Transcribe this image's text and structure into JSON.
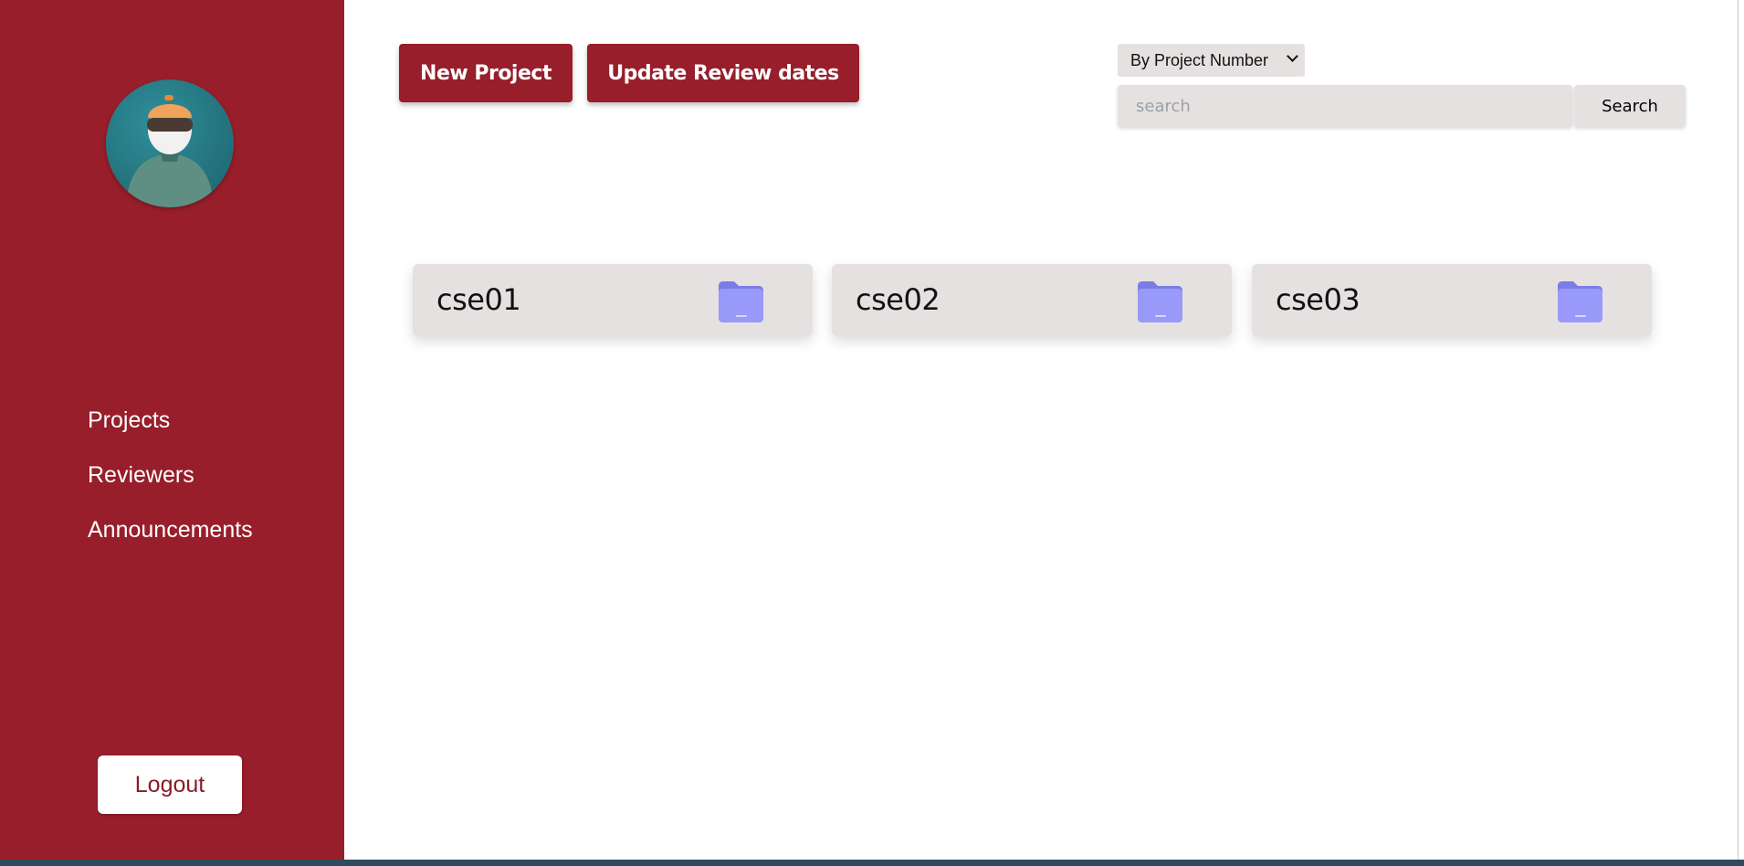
{
  "sidebar": {
    "nav": [
      "Projects",
      "Reviewers",
      "Announcements"
    ],
    "logout_label": "Logout"
  },
  "toolbar": {
    "new_project_label": "New Project",
    "update_review_label": "Update Review dates"
  },
  "search": {
    "sort_selected": "By Project Number",
    "placeholder": "search",
    "button_label": "Search"
  },
  "projects": [
    {
      "name": "cse01",
      "icon": "folder-icon"
    },
    {
      "name": "cse02",
      "icon": "folder-icon"
    },
    {
      "name": "cse03",
      "icon": "folder-icon"
    }
  ],
  "colors": {
    "brand": "#971e2a",
    "card": "#e6e1e1",
    "folder": "#8b8cf2"
  }
}
